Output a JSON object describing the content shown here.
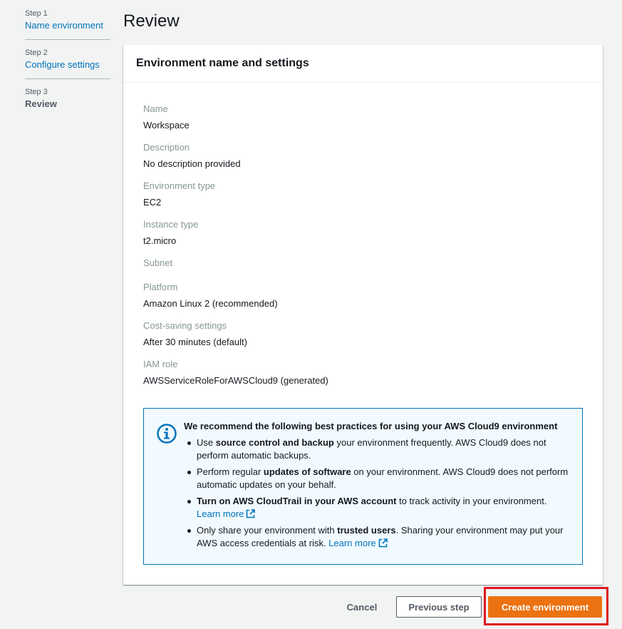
{
  "steps": [
    {
      "num": "Step 1",
      "label": "Name environment"
    },
    {
      "num": "Step 2",
      "label": "Configure settings"
    },
    {
      "num": "Step 3",
      "label": "Review"
    }
  ],
  "page_title": "Review",
  "panel": {
    "title": "Environment name and settings",
    "fields": [
      {
        "label": "Name",
        "value": "Workspace"
      },
      {
        "label": "Description",
        "value": "No description provided"
      },
      {
        "label": "Environment type",
        "value": "EC2"
      },
      {
        "label": "Instance type",
        "value": "t2.micro"
      },
      {
        "label": "Subnet",
        "value": ""
      },
      {
        "label": "Platform",
        "value": "Amazon Linux 2 (recommended)"
      },
      {
        "label": "Cost-saving settings",
        "value": "After 30 minutes (default)"
      },
      {
        "label": "IAM role",
        "value": "AWSServiceRoleForAWSCloud9 (generated)"
      }
    ]
  },
  "info": {
    "title": "We recommend the following best practices for using your AWS Cloud9 environment",
    "items": [
      {
        "pre": "Use ",
        "bold": "source control and backup",
        "post": " your environment frequently. AWS Cloud9 does not perform automatic backups.",
        "link": ""
      },
      {
        "pre": "Perform regular ",
        "bold": "updates of software",
        "post": " on your environment. AWS Cloud9 does not perform automatic updates on your behalf.",
        "link": ""
      },
      {
        "pre": "",
        "bold": "Turn on AWS CloudTrail in your AWS account",
        "post": " to track activity in your environment. ",
        "link": "Learn more"
      },
      {
        "pre": "Only share your environment with ",
        "bold": "trusted users",
        "post": ". Sharing your environment may put your AWS access credentials at risk. ",
        "link": "Learn more"
      }
    ]
  },
  "actions": {
    "cancel": "Cancel",
    "previous": "Previous step",
    "create": "Create environment"
  },
  "colors": {
    "link": "#0073bb",
    "primary_button": "#ec7211",
    "highlight": "#e0141e",
    "info_border": "#0073bb"
  },
  "icons": {
    "info": "info-circle-icon",
    "external": "external-link-icon"
  }
}
